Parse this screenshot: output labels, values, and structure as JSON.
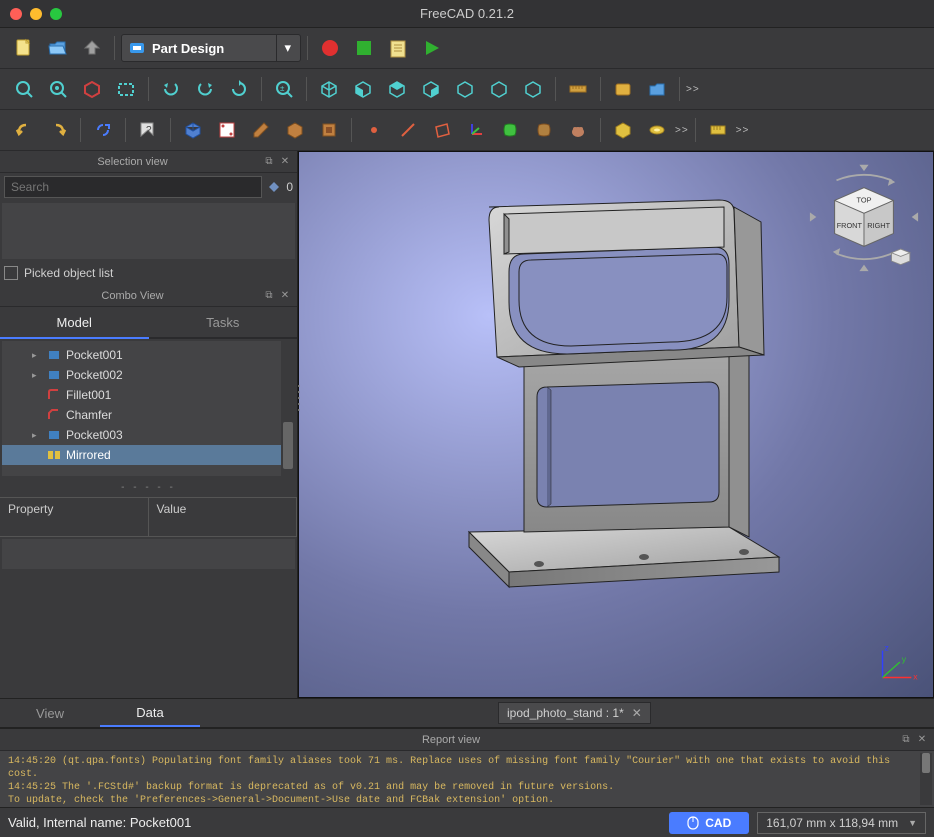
{
  "title": "FreeCAD 0.21.2",
  "workbench": {
    "label": "Part Design"
  },
  "panels": {
    "selection_view": {
      "title": "Selection view",
      "search_placeholder": "Search",
      "count": "0",
      "picked_label": "Picked object list"
    },
    "combo_view": {
      "title": "Combo View"
    },
    "report_view": {
      "title": "Report view"
    }
  },
  "combo_tabs": {
    "model": "Model",
    "tasks": "Tasks"
  },
  "tree": {
    "items": [
      {
        "label": "Pocket001",
        "expandable": true
      },
      {
        "label": "Pocket002",
        "expandable": true
      },
      {
        "label": "Fillet001",
        "expandable": false
      },
      {
        "label": "Chamfer",
        "expandable": false
      },
      {
        "label": "Pocket003",
        "expandable": true
      },
      {
        "label": "Mirrored",
        "expandable": false,
        "selected": true
      }
    ]
  },
  "property": {
    "col1": "Property",
    "col2": "Value"
  },
  "bottom_tabs": {
    "view": "View",
    "data": "Data"
  },
  "document_tab": "ipod_photo_stand : 1*",
  "report_lines": [
    "14:45:20  (qt.qpa.fonts) Populating font family aliases took 71 ms. Replace uses of missing font family \"Courier\" with one that exists to avoid this cost.",
    "14:45:25  The '.FCStd#' backup format is deprecated as of v0.21 and may be removed in future versions.",
    "To update, check the 'Preferences->General->Document->Use date and FCBak extension' option."
  ],
  "statusbar": {
    "message": "Valid, Internal name: Pocket001",
    "cad": "CAD",
    "dimensions": "161,07 mm x 118,94 mm"
  },
  "navcube": {
    "top": "TOP",
    "front": "FRONT",
    "right": "RIGHT"
  },
  "axes": {
    "x": "x",
    "y": "y",
    "z": "z"
  }
}
